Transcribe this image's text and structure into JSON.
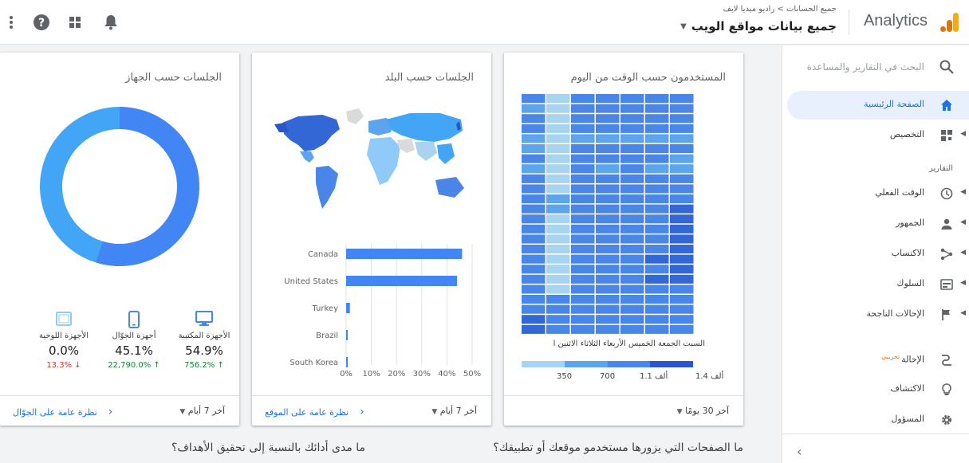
{
  "header": {
    "brand": "Analytics",
    "breadcrumb": "جميع الحسابات > راديو ميديا لايف",
    "property": "جميع بيانات مواقع الويب"
  },
  "sidebar": {
    "search_placeholder": "البحث في التقارير والمساعدة",
    "reports_label": "التقارير",
    "items": [
      {
        "label": "الصفحة الرئيسية",
        "icon": "home-icon"
      },
      {
        "label": "التخصيص",
        "icon": "dashboard-icon"
      },
      {
        "label": "الوقت الفعلي",
        "icon": "clock-icon"
      },
      {
        "label": "الجمهور",
        "icon": "person-icon"
      },
      {
        "label": "الاكتساب",
        "icon": "acquisition-icon"
      },
      {
        "label": "السلوك",
        "icon": "behavior-icon"
      },
      {
        "label": "الإحالات الناجحة",
        "icon": "flag-icon"
      },
      {
        "label": "الإحالة",
        "icon": "attribution-icon",
        "badge": "تجريبي"
      },
      {
        "label": "الاكتشاف",
        "icon": "lightbulb-icon"
      },
      {
        "label": "المسؤول",
        "icon": "gear-icon"
      }
    ]
  },
  "card_time": {
    "title": "المستخدمون حسب الوقت من اليوم",
    "days": "السبت الجمعة الخميس الأربعاء الثلاثاء الاثنين ا",
    "legend": [
      "350",
      "700",
      "1.1 ألف",
      "1.4 ألف"
    ],
    "range": "آخر 30 يومًا",
    "colors": [
      "#a8d4f0",
      "#5ca4ec",
      "#4a86e8",
      "#3367d6",
      "#2a56c6"
    ],
    "grid": [
      [
        2,
        0,
        2,
        2,
        2,
        2,
        2
      ],
      [
        1,
        0,
        2,
        2,
        2,
        2,
        2
      ],
      [
        2,
        0,
        2,
        2,
        2,
        2,
        2
      ],
      [
        2,
        0,
        2,
        2,
        2,
        2,
        2
      ],
      [
        1,
        0,
        1,
        1,
        1,
        1,
        1
      ],
      [
        1,
        0,
        2,
        2,
        2,
        2,
        2
      ],
      [
        2,
        0,
        2,
        2,
        2,
        2,
        1
      ],
      [
        1,
        0,
        2,
        1,
        2,
        1,
        1
      ],
      [
        2,
        0,
        2,
        2,
        2,
        2,
        2
      ],
      [
        2,
        0,
        2,
        2,
        2,
        2,
        2
      ],
      [
        2,
        1,
        2,
        2,
        2,
        2,
        2
      ],
      [
        2,
        1,
        2,
        2,
        2,
        2,
        3
      ],
      [
        2,
        0,
        2,
        2,
        2,
        2,
        3
      ],
      [
        2,
        0,
        2,
        2,
        2,
        2,
        3
      ],
      [
        2,
        0,
        2,
        2,
        2,
        2,
        3
      ],
      [
        2,
        0,
        2,
        2,
        2,
        2,
        3
      ],
      [
        2,
        0,
        2,
        2,
        2,
        3,
        3
      ],
      [
        2,
        0,
        2,
        2,
        2,
        2,
        3
      ],
      [
        2,
        0,
        2,
        2,
        2,
        3,
        3
      ],
      [
        2,
        0,
        2,
        2,
        2,
        2,
        2
      ],
      [
        2,
        2,
        2,
        2,
        2,
        2,
        2
      ],
      [
        2,
        2,
        2,
        2,
        2,
        2,
        2
      ],
      [
        3,
        2,
        2,
        2,
        2,
        2,
        2
      ],
      [
        3,
        2,
        2,
        2,
        2,
        2,
        2
      ]
    ]
  },
  "card_country": {
    "title": "الجلسات حسب البلد",
    "range": "آخر 7 أيام",
    "link": "نظرة عامة على الموقع",
    "chart_data": {
      "type": "bar",
      "categories": [
        "Canada",
        "United States",
        "Turkey",
        "Brazil",
        "South Korea"
      ],
      "values": [
        46,
        44,
        1.5,
        0.5,
        0.3
      ],
      "xticks": [
        "0%",
        "10%",
        "20%",
        "30%",
        "40%",
        "50%"
      ],
      "xlim": [
        0,
        50
      ]
    }
  },
  "card_device": {
    "title": "الجلسات حسب الجهاز",
    "range": "آخر 7 أيام",
    "link": "نظرة عامة على الجوّال",
    "chart_data": {
      "type": "pie",
      "categories": [
        "الأجهزة المكتبية",
        "أجهزة الجوّال",
        "الأجهزة اللوحية"
      ],
      "values": [
        54.9,
        45.1,
        0.0
      ],
      "colors": [
        "#4285f4",
        "#42a5f5",
        "#90caf9"
      ]
    },
    "devices": [
      {
        "label": "الأجهزة المكتبية",
        "value": "54.9%",
        "change": "756.2%",
        "dir": "up",
        "icon": "desktop-icon"
      },
      {
        "label": "أجهزة الجوّال",
        "value": "45.1%",
        "change": "22,790.0%",
        "dir": "up",
        "icon": "mobile-icon"
      },
      {
        "label": "الأجهزة اللوحية",
        "value": "0.0%",
        "change": "13.3%",
        "dir": "down",
        "icon": "tablet-icon"
      }
    ]
  },
  "bottom": {
    "q1": "ما الصفحات التي يزورها مستخدمو موقعك أو تطبيقك؟",
    "q2": "ما مدى أدائك بالنسبة إلى تحقيق الأهداف؟"
  }
}
